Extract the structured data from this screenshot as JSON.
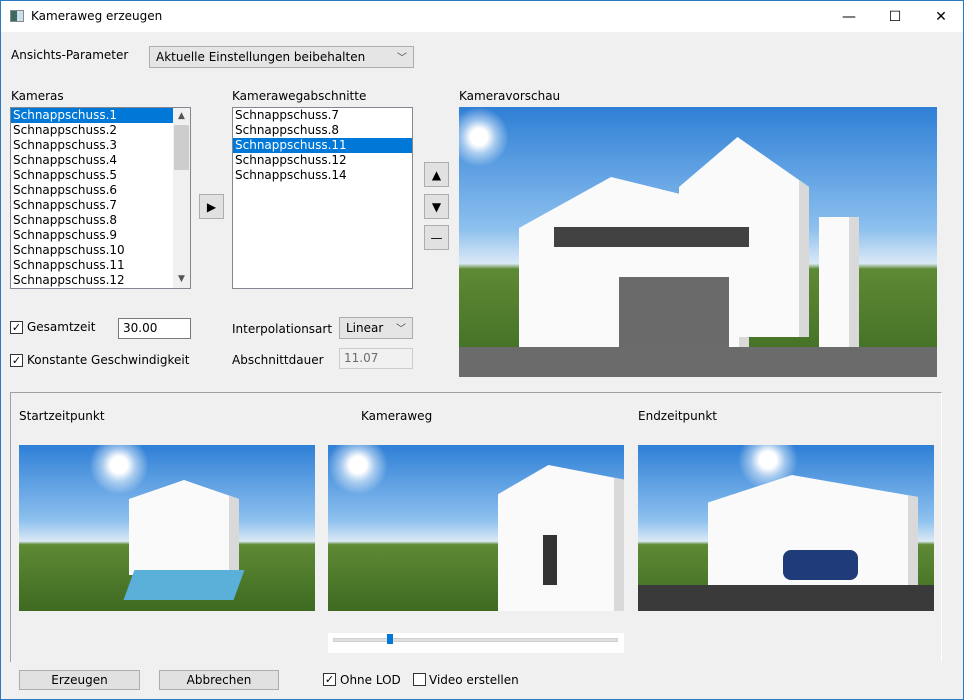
{
  "window": {
    "title": "Kameraweg erzeugen",
    "minimize": "—",
    "maximize": "☐",
    "close": "✕"
  },
  "view_params": {
    "label": "Ansichts-Parameter",
    "value": "Aktuelle Einstellungen beibehalten"
  },
  "cameras": {
    "label": "Kameras",
    "items": [
      "Schnappschuss.1",
      "Schnappschuss.2",
      "Schnappschuss.3",
      "Schnappschuss.4",
      "Schnappschuss.5",
      "Schnappschuss.6",
      "Schnappschuss.7",
      "Schnappschuss.8",
      "Schnappschuss.9",
      "Schnappschuss.10",
      "Schnappschuss.11",
      "Schnappschuss.12"
    ],
    "selected": 0
  },
  "segments": {
    "label": "Kamerawegabschnitte",
    "items": [
      "Schnappschuss.7",
      "Schnappschuss.8",
      "Schnappschuss.11",
      "Schnappschuss.12",
      "Schnappschuss.14"
    ],
    "selected": 2
  },
  "buttons": {
    "add": "▶",
    "up": "▲",
    "down": "▼",
    "remove": "—",
    "create": "Erzeugen",
    "cancel": "Abbrechen"
  },
  "total_time": {
    "label": "Gesamtzeit",
    "checked": true,
    "value": "30.00"
  },
  "constant_speed": {
    "label": "Konstante Geschwindigkeit",
    "checked": true
  },
  "interpolation": {
    "label": "Interpolationsart",
    "value": "Linear"
  },
  "segment_duration": {
    "label": "Abschnittdauer",
    "value": "11.07"
  },
  "preview": {
    "label": "Kameravorschau"
  },
  "start": {
    "label": "Startzeitpunkt"
  },
  "path": {
    "label": "Kameraweg",
    "slider_fraction": 0.2
  },
  "end": {
    "label": "Endzeitpunkt"
  },
  "no_lod": {
    "label": "Ohne LOD",
    "checked": true
  },
  "video": {
    "label": "Video erstellen",
    "checked": false
  },
  "check_mark": "✓"
}
